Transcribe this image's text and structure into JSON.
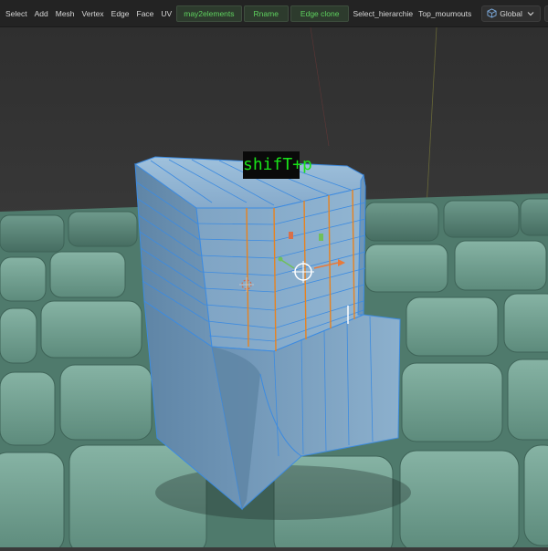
{
  "header": {
    "menus": [
      "Select",
      "Add",
      "Mesh",
      "Vertex",
      "Edge",
      "Face",
      "UV"
    ],
    "buttons": {
      "may2elements": "may2elements",
      "rename": "Rname",
      "edge_clone": "Edge clone",
      "select_hierarchie": "Select_hierarchie",
      "top_mountouts": "Top_moumouts"
    },
    "transform_orientation": "Global",
    "icons": [
      "cube-icon",
      "chevron-down-icon",
      "link-icon",
      "magnet-icon",
      "snap-grid-icon",
      "proportional-icon",
      "curve-icon"
    ]
  },
  "overlay": {
    "shortcut_label": "shifT+p"
  },
  "colors": {
    "header_bg": "#232323",
    "viewport_bg": "#3a3a3a",
    "floor_tile": "#6b9a8b",
    "mesh_blue": "#7fa6c7",
    "wire_blue": "#3d8be0",
    "accent_green": "#5fd35f",
    "overlay_green": "#19e319",
    "edge_orange": "#e8821e"
  }
}
